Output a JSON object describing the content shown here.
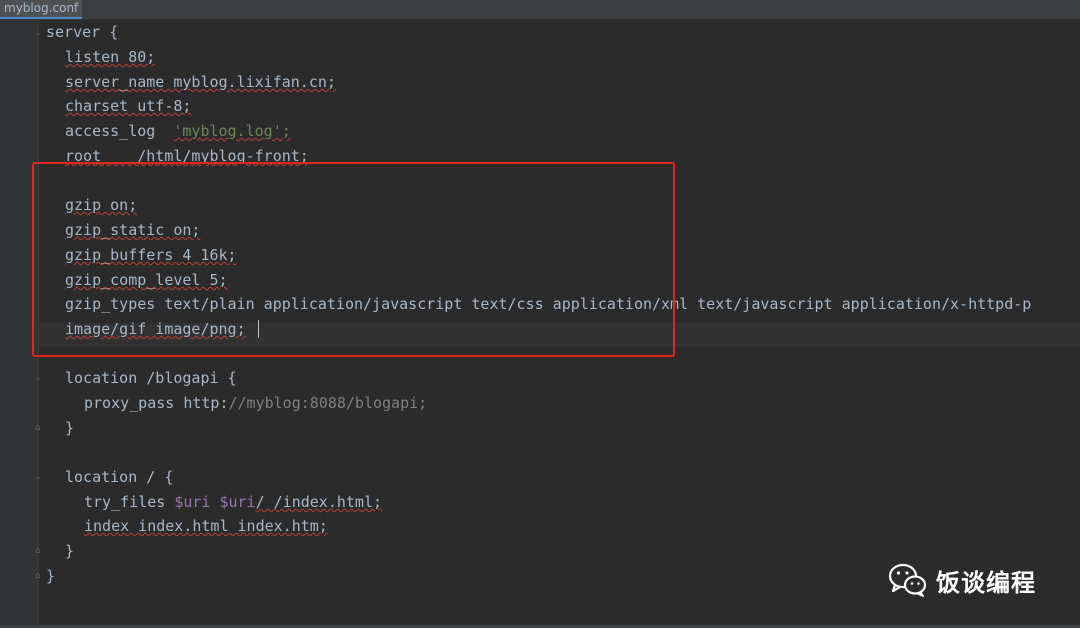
{
  "tab": {
    "label": "myblog.conf"
  },
  "code": {
    "l1": "server {",
    "l2": "listen 80;",
    "l3": "server_name myblog.lixifan.cn;",
    "l4": "charset utf-8;",
    "l5_key": "access_log  ",
    "l5_val": "'myblog.log';",
    "l6": "root    /html/myblog-front;",
    "l8": "gzip on;",
    "l9": "gzip_static on;",
    "l10": "gzip_buffers 4 16k;",
    "l11": "gzip_comp_level 5;",
    "l12": "gzip_types text/plain application/javascript text/css application/xml text/javascript application/x-httpd-p",
    "l13": "image/gif image/png;",
    "l15": "location /blogapi {",
    "l16_key": "proxy_pass http:",
    "l16_rest": "//myblog:8088/blogapi;",
    "l17": "}",
    "l19": "location / {",
    "l20_a": "try_files ",
    "l20_v1": "$uri",
    "l20_b": " ",
    "l20_v2": "$uri",
    "l20_c": "/ /index.html;",
    "l21": "index index.html index.htm;",
    "l22": "}",
    "l23": "}"
  },
  "watermark": {
    "text": "饭谈编程",
    "icon": "wechat-icon"
  },
  "colors": {
    "highlight": "#e0281e",
    "background": "#2b2b2b",
    "text": "#a9b7c6"
  }
}
